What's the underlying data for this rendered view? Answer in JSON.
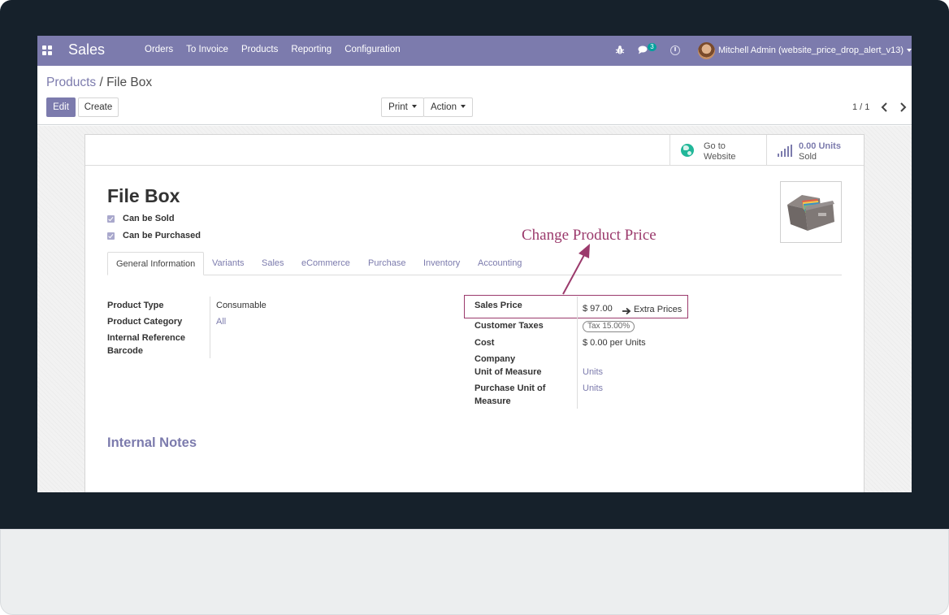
{
  "navbar": {
    "app_name": "Sales",
    "menu": [
      "Orders",
      "To Invoice",
      "Products",
      "Reporting",
      "Configuration"
    ],
    "chat_count": "3",
    "user_name": "Mitchell Admin (website_price_drop_alert_v13)"
  },
  "control_panel": {
    "breadcrumb_parent": "Products",
    "breadcrumb_separator": " / ",
    "breadcrumb_current": "File Box",
    "edit_label": "Edit",
    "create_label": "Create",
    "print_label": "Print",
    "action_label": "Action",
    "pager": "1 / 1"
  },
  "smart_buttons": {
    "website_line1": "Go to",
    "website_line2": "Website",
    "sold_value": "0.00 Units",
    "sold_label": "Sold"
  },
  "product": {
    "title": "File Box",
    "can_be_sold": "Can be Sold",
    "can_be_purchased": "Can be Purchased"
  },
  "tabs": [
    "General Information",
    "Variants",
    "Sales",
    "eCommerce",
    "Purchase",
    "Inventory",
    "Accounting"
  ],
  "left_fields": {
    "product_type_label": "Product Type",
    "product_type_value": "Consumable",
    "product_category_label": "Product Category",
    "product_category_value": "All",
    "internal_reference_label": "Internal Reference",
    "barcode_label": "Barcode"
  },
  "right_fields": {
    "sales_price_label": "Sales Price",
    "sales_price_value": "$ 97.00",
    "extra_prices_label": "Extra Prices",
    "customer_taxes_label": "Customer Taxes",
    "customer_taxes_value": "Tax 15.00%",
    "cost_label": "Cost",
    "cost_value": "$ 0.00",
    "cost_unit": "per Units",
    "company_label": "Company",
    "uom_label": "Unit of Measure",
    "uom_value": "Units",
    "purchase_uom_label_line1": "Purchase Unit of",
    "purchase_uom_label_line2": "Measure",
    "purchase_uom_value": "Units"
  },
  "annotation": {
    "text": "Change Product Price",
    "color": "#9b3a6c"
  },
  "internal_notes_title": "Internal Notes",
  "colors": {
    "brand": "#7c7bad",
    "frame": "#16212b",
    "accent_green": "#21b799"
  }
}
